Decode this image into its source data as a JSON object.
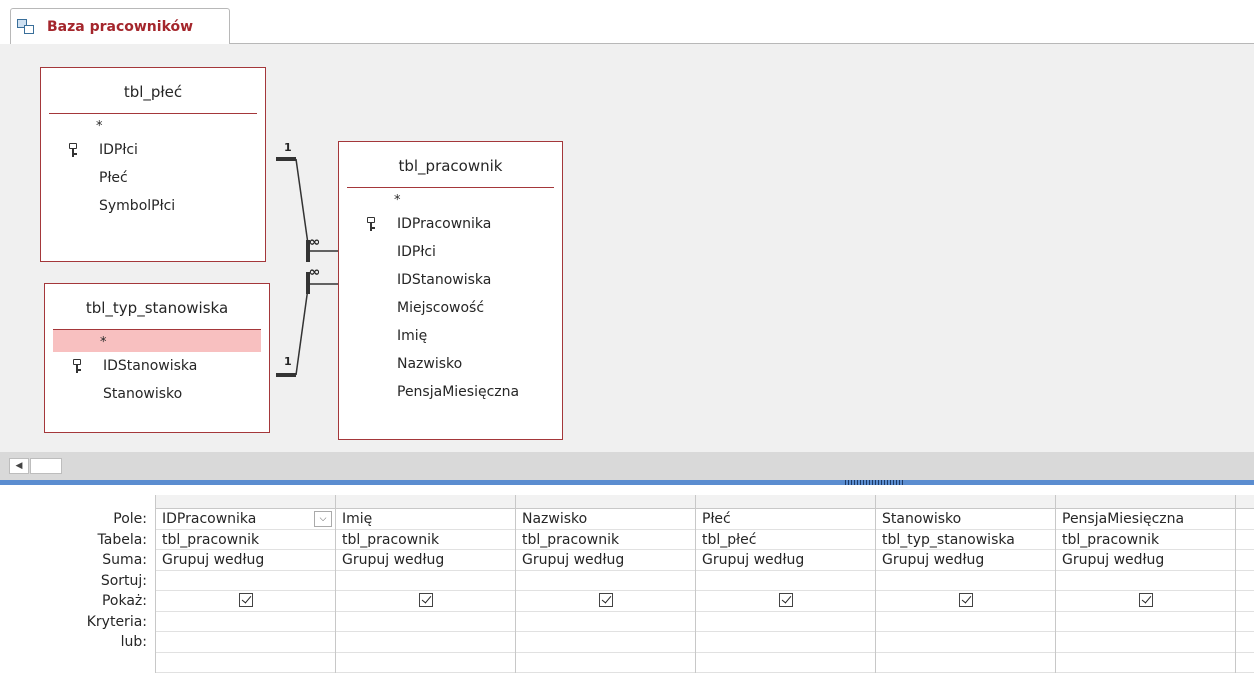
{
  "tab": {
    "title": "Baza pracowników",
    "icon": "query-design-icon"
  },
  "tables": {
    "plec": {
      "title": "tbl_płeć",
      "star": "*",
      "fields": [
        "IDPłci",
        "Płeć",
        "SymbolPłci"
      ]
    },
    "typ": {
      "title": "tbl_typ_stanowiska",
      "star": "*",
      "fields": [
        "IDStanowiska",
        "Stanowisko"
      ]
    },
    "pracownik": {
      "title": "tbl_pracownik",
      "star": "*",
      "fields": [
        "IDPracownika",
        "IDPłci",
        "IDStanowiska",
        "Miejscowość",
        "Imię",
        "Nazwisko",
        "PensjaMiesięczna"
      ]
    }
  },
  "relations": {
    "one": "1",
    "many": "∞"
  },
  "scroll": {
    "left_arrow": "◀"
  },
  "grid": {
    "row_labels": [
      "Pole:",
      "Tabela:",
      "Suma:",
      "Sortuj:",
      "Pokaż:",
      "Kryteria:",
      "lub:"
    ],
    "columns": [
      {
        "field": "IDPracownika",
        "table": "tbl_pracownik",
        "total": "Grupuj według",
        "show": true
      },
      {
        "field": "Imię",
        "table": "tbl_pracownik",
        "total": "Grupuj według",
        "show": true
      },
      {
        "field": "Nazwisko",
        "table": "tbl_pracownik",
        "total": "Grupuj według",
        "show": true
      },
      {
        "field": "Płeć",
        "table": "tbl_płeć",
        "total": "Grupuj według",
        "show": true
      },
      {
        "field": "Stanowisko",
        "table": "tbl_typ_stanowiska",
        "total": "Grupuj według",
        "show": true
      },
      {
        "field": "PensjaMiesięczna",
        "table": "tbl_pracownik",
        "total": "Grupuj według",
        "show": true
      }
    ],
    "dropdown_glyph": "⌵"
  }
}
